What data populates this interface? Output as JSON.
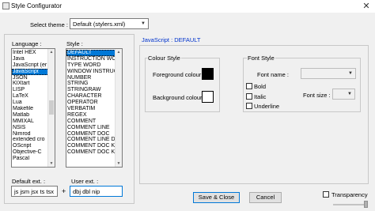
{
  "window": {
    "title": "Style Configurator",
    "close_glyph": "✕"
  },
  "theme": {
    "label": "Select theme :",
    "value": "Default (stylers.xml)"
  },
  "language": {
    "label": "Language :",
    "items": [
      "Intel HEX",
      "Java",
      "JavaScript (er",
      "JavaScript",
      "JSON",
      "KIXtart",
      "LISP",
      "LaTeX",
      "Lua",
      "Makefile",
      "Matlab",
      "MMIXAL",
      "NSIS",
      "Nimrod",
      "extended cro",
      "OScript",
      "Objective-C",
      "Pascal"
    ],
    "selected_index": 3
  },
  "style": {
    "label": "Style :",
    "items": [
      "DEFAULT",
      "INSTRUCTION WORD",
      "TYPE WORD",
      "WINDOW INSTRUCTI",
      "NUMBER",
      "STRING",
      "STRINGRAW",
      "CHARACTER",
      "OPERATOR",
      "VERBATIM",
      "REGEX",
      "COMMENT",
      "COMMENT LINE",
      "COMMENT DOC",
      "COMMENT LINE DOC",
      "COMMENT DOC KEYW",
      "COMMENT DOC KEYW"
    ],
    "selected_index": 0
  },
  "extensions": {
    "default_label": "Default ext. :",
    "default_value": "js jsm jsx ts tsx",
    "plus": "+",
    "user_label": "User ext. :",
    "user_value": "dbj dbl nip"
  },
  "style_title": "JavaScript : DEFAULT",
  "colour_style": {
    "legend": "Colour Style",
    "foreground_label": "Foreground colour",
    "background_label": "Background colour",
    "foreground_color": "#000000",
    "background_color": "#ffffff"
  },
  "font_style": {
    "legend": "Font Style",
    "name_label": "Font name :",
    "name_value": "",
    "size_label": "Font size :",
    "size_value": "",
    "bold": "Bold",
    "italic": "Italic",
    "underline": "Underline"
  },
  "buttons": {
    "save_close": "Save & Close",
    "cancel": "Cancel"
  },
  "transparency": {
    "label": "Transparency"
  },
  "icons": {
    "dropdown": "▼",
    "scroll_up": "▲",
    "scroll_down": "▼"
  },
  "colors": {
    "selection": "#0078d7",
    "style_title": "#0033cc",
    "window_bg": "#f0f0f0"
  }
}
